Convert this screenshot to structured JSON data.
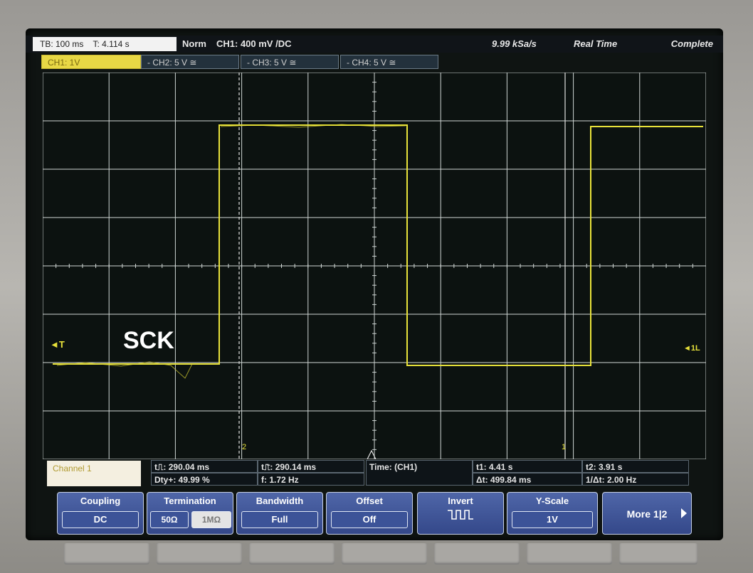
{
  "status_bar": {
    "timebase": "TB: 100 ms",
    "trigger_time": "T: 4.114 s",
    "trigger_mode": "Norm",
    "ch1_setting": "CH1: 400 mV /DC",
    "sample_rate": "9.99 kSa/s",
    "acq_mode": "Real Time",
    "acq_status": "Complete"
  },
  "channel_tabs": [
    {
      "label": "CH1: 1V"
    },
    {
      "label": "- CH2: 5 V ≅"
    },
    {
      "label": "- CH3: 5 V ≅"
    },
    {
      "label": "- CH4: 5 V ≅"
    }
  ],
  "waveform": {
    "label": "SCK",
    "color": "#e8e23a",
    "trigger_marker": "◄T",
    "ch1_marker": "◄1L",
    "cursor1_label": "2",
    "cursor2_label": "1"
  },
  "measurements": {
    "channel": "Channel 1",
    "pos_width": "t⎍: 290.04 ms",
    "neg_width": "t⎍̄: 290.14 ms",
    "duty": "Dty+: 49.99 %",
    "freq": "f: 1.72 Hz",
    "time_source": "Time:  (CH1)",
    "t1": "t1: 4.41 s",
    "t2": "t2: 3.91 s",
    "delta_t": "Δt: 499.84 ms",
    "inv_delta_t": "1/Δt: 2.00 Hz"
  },
  "softkeys": {
    "coupling": {
      "label": "Coupling",
      "value": "DC"
    },
    "termination": {
      "label": "Termination",
      "value_a": "50Ω",
      "value_b": "1MΩ"
    },
    "bandwidth": {
      "label": "Bandwidth",
      "value": "Full"
    },
    "offset": {
      "label": "Offset",
      "value": "Off"
    },
    "invert": {
      "label": "Invert"
    },
    "yscale": {
      "label": "Y-Scale",
      "value": "1V"
    },
    "more": {
      "label": "More 1|2"
    }
  }
}
